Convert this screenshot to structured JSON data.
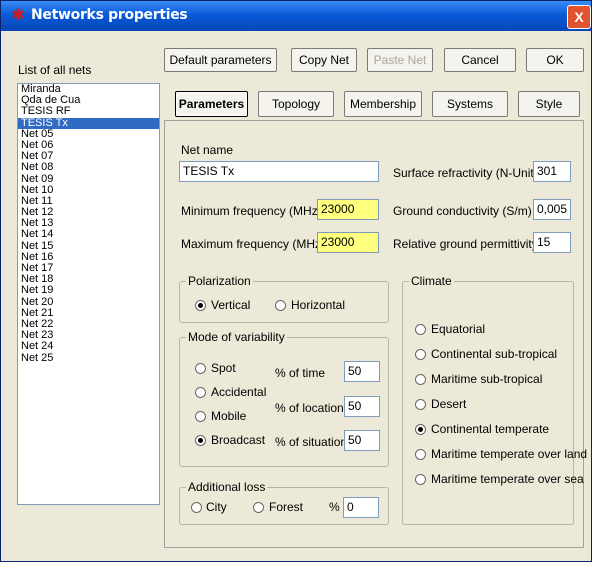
{
  "window": {
    "title": "Networks properties",
    "close": "X"
  },
  "list": {
    "label": "List of all nets",
    "items": [
      "Miranda",
      "Qda de Cua",
      "TESIS RF",
      "TESIS Tx",
      "Net 05",
      "Net 06",
      "Net 07",
      "Net 08",
      "Net 09",
      "Net 10",
      "Net 11",
      "Net 12",
      "Net 13",
      "Net 14",
      "Net 15",
      "Net 16",
      "Net 17",
      "Net 18",
      "Net 19",
      "Net 20",
      "Net 21",
      "Net 22",
      "Net 23",
      "Net 24",
      "Net 25"
    ],
    "selected_index": 3
  },
  "toolbar": {
    "default": "Default parameters",
    "copy": "Copy Net",
    "paste": "Paste Net",
    "cancel": "Cancel",
    "ok": "OK"
  },
  "tabs": [
    "Parameters",
    "Topology",
    "Membership",
    "Systems",
    "Style"
  ],
  "params": {
    "net_name_label": "Net name",
    "net_name": "TESIS Tx",
    "min_freq_label": "Minimum frequency (MHz)",
    "min_freq": "23000",
    "max_freq_label": "Maximum frequency (MHz)",
    "max_freq": "23000",
    "refractivity_label": "Surface refractivity (N-Units)",
    "refractivity": "301",
    "conductivity_label": "Ground conductivity (S/m)",
    "conductivity": "0,005",
    "permittivity_label": "Relative ground permittivity",
    "permittivity": "15"
  },
  "polarization": {
    "title": "Polarization",
    "vertical": "Vertical",
    "horizontal": "Horizontal"
  },
  "variability": {
    "title": "Mode of variability",
    "spot": "Spot",
    "accidental": "Accidental",
    "mobile": "Mobile",
    "broadcast": "Broadcast",
    "time_label": "% of time",
    "time": "50",
    "locations_label": "% of locations",
    "locations": "50",
    "situations_label": "% of situations",
    "situations": "50"
  },
  "loss": {
    "title": "Additional loss",
    "city": "City",
    "forest": "Forest",
    "pct_label": "%",
    "pct": "0"
  },
  "climate": {
    "title": "Climate",
    "options": [
      "Equatorial",
      "Continental sub-tropical",
      "Maritime sub-tropical",
      "Desert",
      "Continental temperate",
      "Maritime temperate over land",
      "Maritime temperate over sea"
    ],
    "selected_index": 4
  }
}
